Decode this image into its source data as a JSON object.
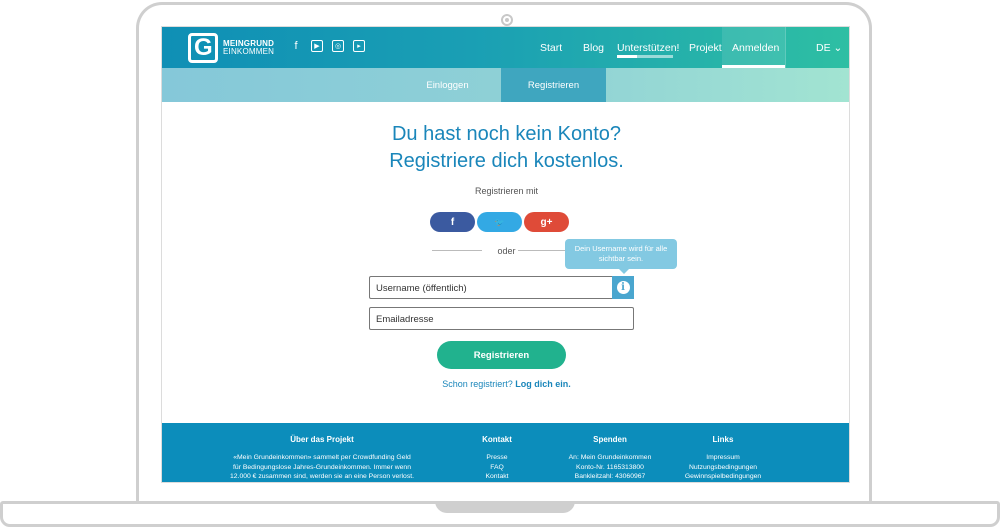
{
  "header": {
    "logo_line1": "MEINGRUND",
    "logo_line2": "EINKOMMEN",
    "logo_letter": "G",
    "socials": [
      "facebook-icon",
      "youtube-icon",
      "instagram-icon",
      "video-icon"
    ],
    "nav": [
      "Start",
      "Blog",
      "Unterstützen!",
      "Projekt",
      "Anmelden"
    ],
    "lang": "DE",
    "lang_chevron": "⌄"
  },
  "subnav": {
    "login": "Einloggen",
    "register": "Registrieren"
  },
  "main": {
    "heading_line1": "Du hast noch kein Konto?",
    "heading_line2": "Registriere dich kostenlos.",
    "register_with": "Registrieren mit",
    "facebook_label": "f",
    "twitter_label": "🐦",
    "google_label": "g+",
    "or": "oder",
    "tooltip": "Dein Username wird für alle sichtbar sein.",
    "username_placeholder": "Username (öffentlich)",
    "email_placeholder": "Emailadresse",
    "info_label": "i",
    "submit_label": "Registrieren",
    "already_registered": "Schon registriert?",
    "login_link": "Log dich ein."
  },
  "footer": {
    "about_title": "Über das Projekt",
    "about_text_1": "«Mein Grundeinkommen» sammelt per Crowdfunding Geld",
    "about_text_2": "für Bedingungslose Jahres-Grundeinkommen. Immer wenn",
    "about_text_3": "12.000 € zusammen sind, werden sie an eine Person verlost.",
    "contact_title": "Kontakt",
    "contact_links": [
      "Presse",
      "FAQ",
      "Kontakt"
    ],
    "donate_title": "Spenden",
    "donate_lines": [
      "An: Mein Grundeinkommen",
      "Konto-Nr. 1165313800",
      "Bankleitzahl: 43060967"
    ],
    "links_title": "Links",
    "links": [
      "Impressum",
      "Nutzungsbedingungen",
      "Gewinnspielbedingungen"
    ]
  },
  "colors": {
    "brand_blue": "#1a86ba",
    "brand_green": "#21b28e",
    "footer_blue": "#0c8dbb"
  }
}
